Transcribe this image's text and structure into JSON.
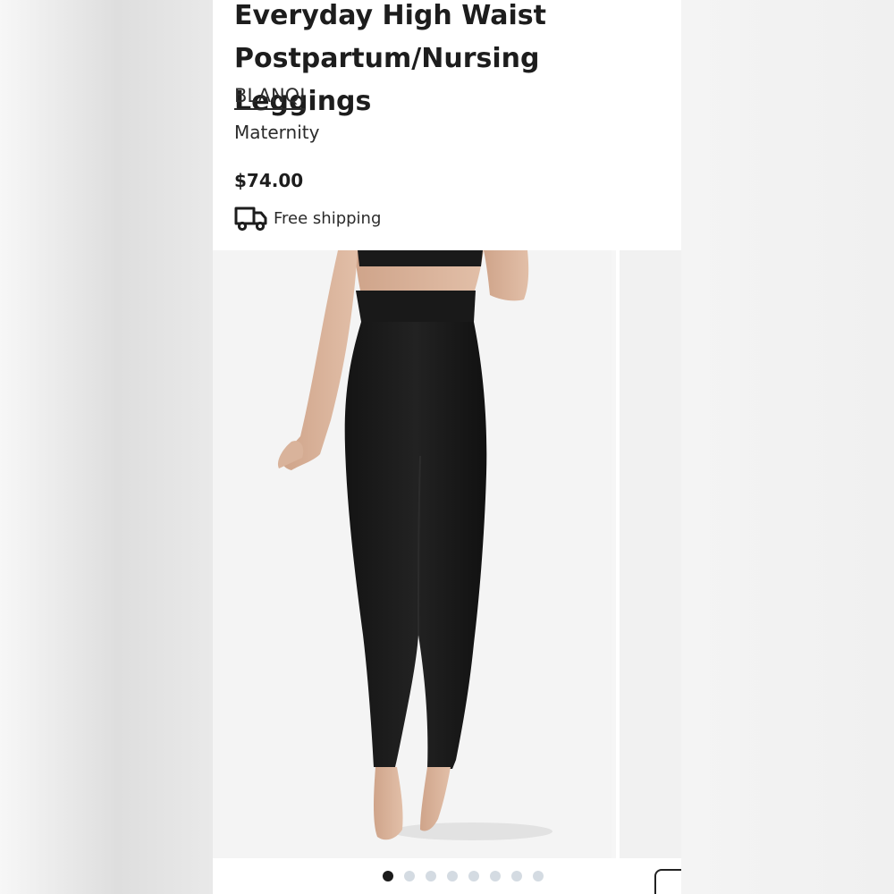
{
  "product": {
    "title": "Everyday High Waist Postpartum/Nursing Leggings",
    "brand": "BLANQI",
    "category": "Maternity",
    "price": "$74.00",
    "shipping_label": "Free shipping",
    "shipping_icon": "truck-icon"
  },
  "gallery": {
    "image_count": 8,
    "active_index": 0,
    "active_dot_color": "#1b1b1b",
    "inactive_dot_color": "#d4dbe2"
  }
}
